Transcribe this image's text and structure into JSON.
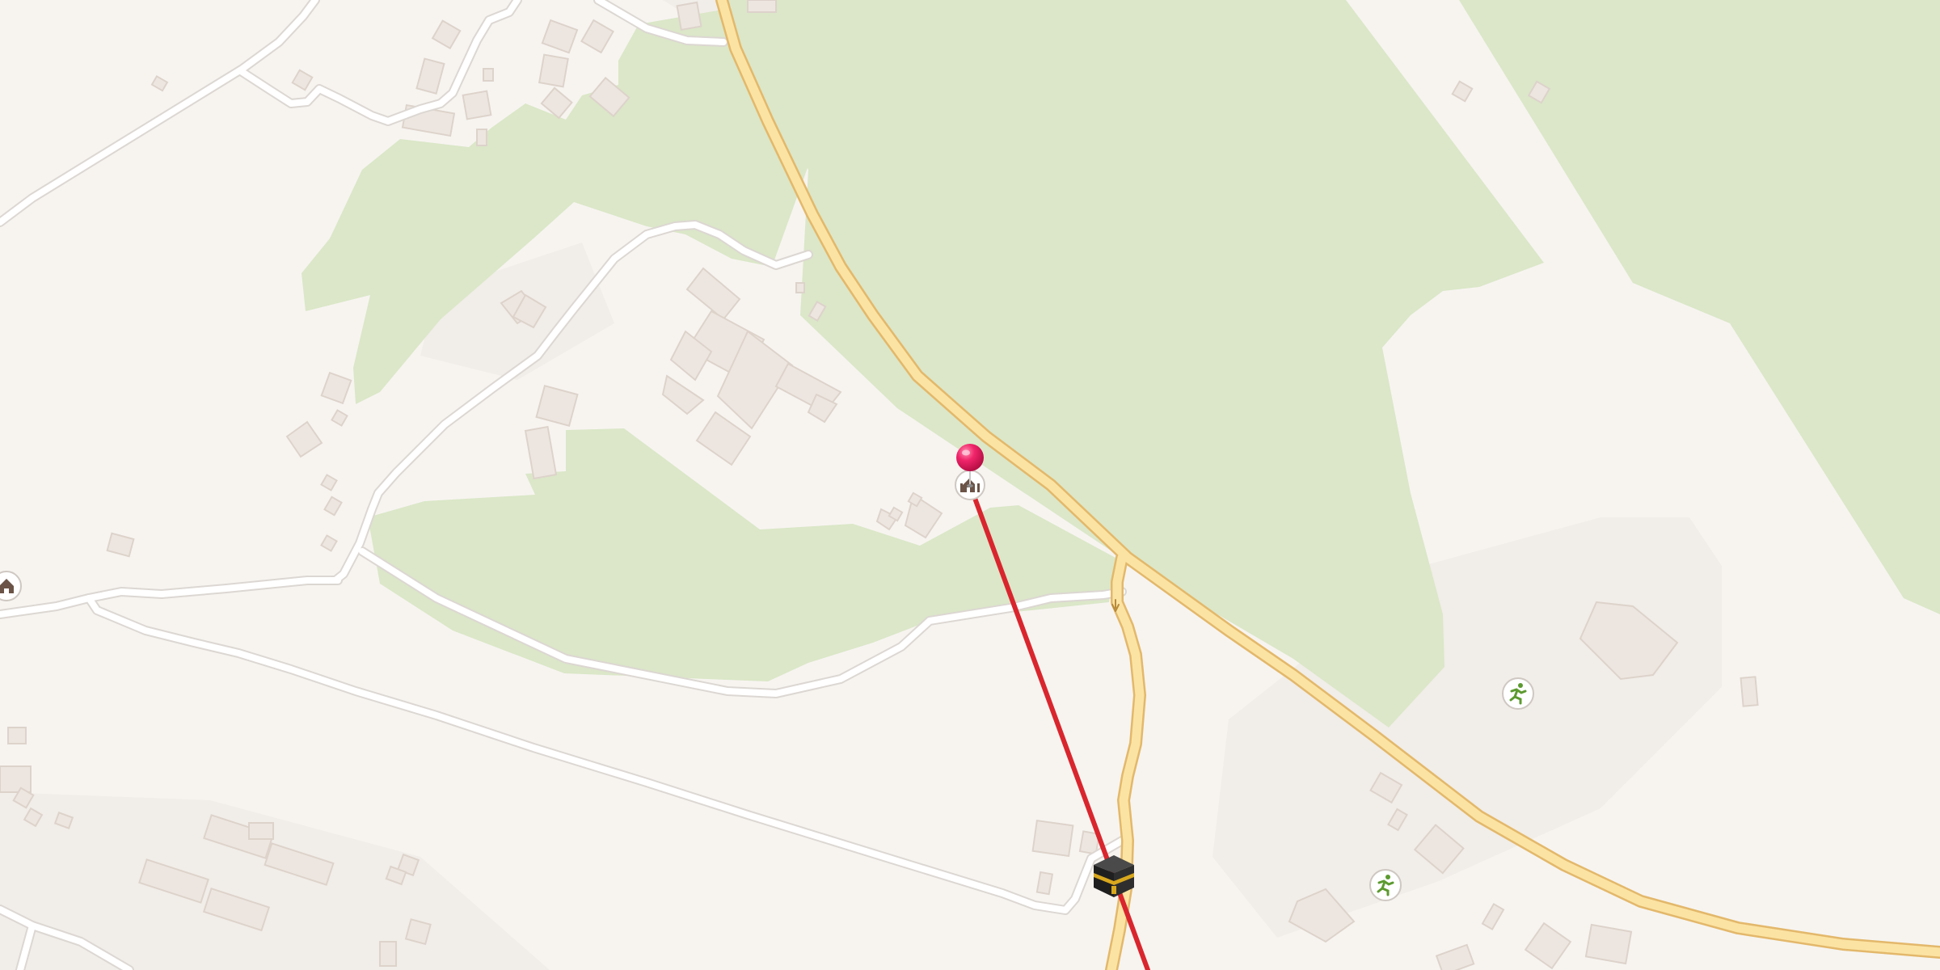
{
  "map": {
    "colors": {
      "land": "#f7f4f0",
      "park": "#dbe7c8",
      "building": "#ede6e0",
      "building_stroke": "#ddd3cb",
      "minor_road": "#ffffff",
      "minor_road_casing": "#dcd7d2",
      "major_road": "#fbe3a3",
      "major_road_casing": "#e3b86b",
      "qibla_line": "#d9262e",
      "pin": "#e8195a"
    },
    "markers": {
      "location_pin": "location-pin-icon",
      "mosque_icon": "mosque-icon",
      "kaaba_icon": "kaaba-icon",
      "sports_icon": "running-person-icon"
    }
  }
}
